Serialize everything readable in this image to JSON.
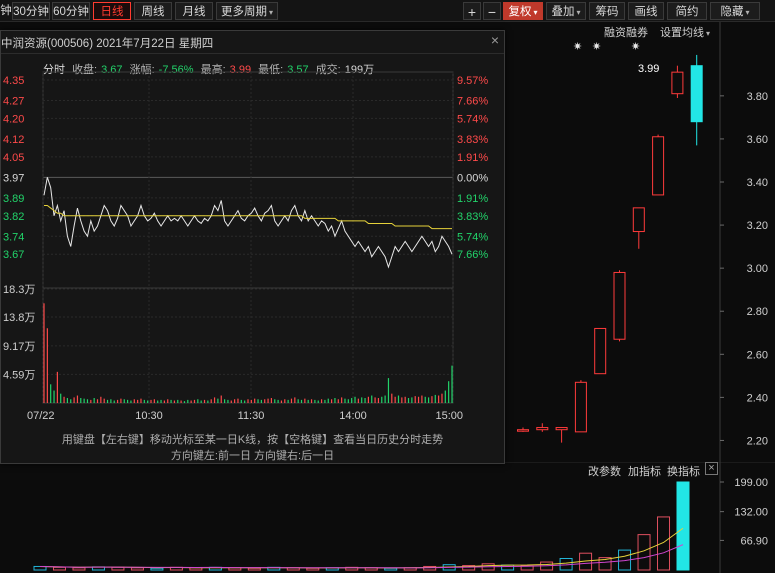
{
  "toolbar": {
    "items": [
      {
        "label": "钟",
        "active": false
      },
      {
        "label": "30分钟",
        "active": false
      },
      {
        "label": "60分钟",
        "active": false
      },
      {
        "label": "日线",
        "active": true
      },
      {
        "label": "周线",
        "active": false
      },
      {
        "label": "月线",
        "active": false
      },
      {
        "label": "更多周期",
        "active": false
      }
    ],
    "right": {
      "plus": "+",
      "minus": "−",
      "fuquan": "复权",
      "diejia": "叠加",
      "chouma": "筹码",
      "huaxian": "画线",
      "jianyue": "简约",
      "yincang": "隐藏"
    },
    "colors": {
      "active": "#ff3b30",
      "fuquan_bg": "#c0392b"
    }
  },
  "main_chart": {
    "top_links": {
      "rongzi": "融资融券",
      "settings": "设置均线"
    },
    "star_glyph": "✷",
    "peak_label": "3.99",
    "price_axis": [
      "3.80",
      "3.60",
      "3.40",
      "3.20",
      "3.00",
      "2.80",
      "2.60",
      "2.40",
      "2.20"
    ]
  },
  "popup": {
    "title": "中润资源(000506) 2021年7月22日 星期四",
    "info": {
      "fenshi": "分时",
      "close_label": "收盘:",
      "close_value": "3.67",
      "change_label": "涨幅:",
      "change_value": "-7.56%",
      "high_label": "最高:",
      "high_value": "3.99",
      "low_label": "最低:",
      "low_value": "3.57",
      "volume_label": "成交:",
      "volume_value": "199万"
    },
    "price_left": [
      "4.35",
      "4.27",
      "4.20",
      "4.12",
      "4.05",
      "3.97",
      "3.89",
      "3.82",
      "3.74",
      "3.67"
    ],
    "pct_right": [
      "9.57%",
      "7.66%",
      "5.74%",
      "3.83%",
      "1.91%",
      "0.00%",
      "1.91%",
      "3.83%",
      "5.74%",
      "7.66%"
    ],
    "vol_axis": [
      "18.3万",
      "13.8万",
      "9.17万",
      "4.59万"
    ],
    "time_axis": [
      "07/22",
      "10:30",
      "11:30",
      "14:00",
      "15:00"
    ],
    "hint1": "用键盘【左右键】移动光标至某一日K线，按【空格键】查看当日历史分时走势",
    "hint2": "方向键左:前一日  方向键右:后一日",
    "close_icon": "×"
  },
  "indicator": {
    "gaicanshu": "改参数",
    "jiazhibiao": "加指标",
    "huanzhibiao": "换指标",
    "close_icon": "×",
    "axis": [
      "199.00",
      "132.00",
      "66.90"
    ]
  },
  "chart_data": {
    "type": "line",
    "title": "中润资源(000506) 2021年7月22日 星期四",
    "prev_close": 3.97,
    "ylim": [
      3.62,
      4.35
    ],
    "x_ticks": [
      "07/22",
      "10:30",
      "11:30",
      "14:00",
      "15:00"
    ],
    "series": [
      {
        "values": [
          3.9,
          3.97,
          3.93,
          3.82,
          3.86,
          3.8,
          3.84,
          3.74,
          3.7,
          3.78,
          3.85,
          3.8,
          3.76,
          3.74,
          3.8,
          3.76,
          3.78,
          3.82,
          3.86,
          3.84,
          3.8,
          3.78,
          3.81,
          3.86,
          3.84,
          3.82,
          3.78,
          3.8,
          3.82,
          3.86,
          3.82,
          3.8,
          3.81,
          3.83,
          3.8,
          3.78,
          3.8,
          3.82,
          3.8,
          3.81,
          3.8,
          3.82,
          3.8,
          3.78,
          3.8,
          3.82,
          3.8,
          3.79,
          3.81,
          3.8,
          3.82,
          3.86,
          3.84,
          3.88,
          3.8,
          3.78,
          3.8,
          3.82,
          3.84,
          3.81,
          3.8,
          3.82,
          3.83,
          3.85,
          3.82,
          3.8,
          3.83,
          3.84,
          3.86,
          3.8,
          3.78,
          3.8,
          3.82,
          3.8,
          3.84,
          3.86,
          3.82,
          3.8,
          3.84,
          3.8,
          3.82,
          3.8,
          3.78,
          3.8,
          3.79,
          3.76,
          3.78,
          3.74,
          3.77,
          3.8,
          3.76,
          3.74,
          3.72,
          3.7,
          3.72,
          3.7,
          3.68,
          3.7,
          3.66,
          3.68,
          3.7,
          3.68,
          3.66,
          3.62,
          3.66,
          3.7,
          3.68,
          3.7,
          3.72,
          3.7,
          3.68,
          3.7,
          3.72,
          3.74,
          3.72,
          3.7,
          3.72,
          3.68,
          3.7,
          3.74,
          3.72,
          3.7,
          3.67
        ]
      },
      {
        "values": [
          3.86,
          3.86,
          3.85,
          3.84,
          3.83,
          3.83,
          3.82,
          3.82,
          3.82,
          3.82,
          3.82,
          3.82,
          3.82,
          3.82,
          3.82,
          3.82,
          3.82,
          3.82,
          3.82,
          3.82,
          3.82,
          3.82,
          3.82,
          3.82,
          3.82,
          3.82,
          3.82,
          3.82,
          3.82,
          3.82,
          3.82,
          3.82,
          3.82,
          3.82,
          3.82,
          3.82,
          3.82,
          3.82,
          3.82,
          3.82,
          3.82,
          3.82,
          3.82,
          3.82,
          3.82,
          3.82,
          3.82,
          3.82,
          3.82,
          3.82,
          3.82,
          3.82,
          3.82,
          3.82,
          3.82,
          3.82,
          3.82,
          3.82,
          3.82,
          3.82,
          3.82,
          3.82,
          3.82,
          3.82,
          3.82,
          3.82,
          3.82,
          3.82,
          3.82,
          3.82,
          3.82,
          3.82,
          3.82,
          3.82,
          3.82,
          3.82,
          3.82,
          3.82,
          3.81,
          3.81,
          3.81,
          3.81,
          3.81,
          3.81,
          3.81,
          3.81,
          3.81,
          3.81,
          3.8,
          3.8,
          3.8,
          3.8,
          3.8,
          3.8,
          3.8,
          3.8,
          3.8,
          3.79,
          3.79,
          3.79,
          3.79,
          3.79,
          3.79,
          3.79,
          3.79,
          3.78,
          3.78,
          3.78,
          3.78,
          3.78,
          3.78,
          3.78,
          3.78,
          3.78,
          3.78,
          3.78,
          3.77,
          3.77,
          3.77,
          3.77,
          3.77,
          3.77,
          3.77
        ]
      }
    ],
    "volume_ylim": [
      0,
      183000
    ],
    "volume": [
      160000,
      120000,
      30000,
      20000,
      50000,
      15000,
      10000,
      8000,
      6000,
      9000,
      12000,
      8000,
      7000,
      6000,
      5000,
      8000,
      6000,
      10000,
      7000,
      5000,
      6000,
      4000,
      5000,
      7000,
      6000,
      5000,
      4000,
      6000,
      5000,
      7000,
      5000,
      4000,
      5000,
      6000,
      4000,
      5000,
      4000,
      6000,
      5000,
      4000,
      5000,
      4000,
      3000,
      5000,
      4000,
      5000,
      6000,
      4000,
      5000,
      4000,
      6000,
      9000,
      7000,
      12000,
      6000,
      5000,
      4000,
      6000,
      7000,
      5000,
      4000,
      6000,
      5000,
      7000,
      6000,
      5000,
      6000,
      7000,
      8000,
      6000,
      5000,
      4000,
      6000,
      5000,
      7000,
      9000,
      6000,
      5000,
      7000,
      5000,
      6000,
      5000,
      4000,
      6000,
      5000,
      7000,
      6000,
      8000,
      6000,
      9000,
      7000,
      6000,
      8000,
      10000,
      7000,
      9000,
      8000,
      10000,
      12000,
      9000,
      8000,
      10000,
      12000,
      40000,
      15000,
      10000,
      12000,
      9000,
      10000,
      8000,
      9000,
      11000,
      10000,
      12000,
      10000,
      9000,
      11000,
      13000,
      12000,
      15000,
      20000,
      35000,
      60000
    ],
    "daily_ylim": [
      2.1,
      4.05
    ],
    "daily_candles": [
      {
        "o": 2.25,
        "h": 2.26,
        "l": 2.24,
        "c": 2.25
      },
      {
        "o": 2.25,
        "h": 2.28,
        "l": 2.24,
        "c": 2.26
      },
      {
        "o": 2.25,
        "h": 2.26,
        "l": 2.19,
        "c": 2.26
      },
      {
        "o": 2.24,
        "h": 2.48,
        "l": 2.24,
        "c": 2.47
      },
      {
        "o": 2.51,
        "h": 2.71,
        "l": 2.51,
        "c": 2.72
      },
      {
        "o": 2.67,
        "h": 2.99,
        "l": 2.66,
        "c": 2.98
      },
      {
        "o": 3.17,
        "h": 3.28,
        "l": 3.09,
        "c": 3.28
      },
      {
        "o": 3.34,
        "h": 3.62,
        "l": 3.34,
        "c": 3.61
      },
      {
        "o": 3.81,
        "h": 3.94,
        "l": 3.79,
        "c": 3.91
      },
      {
        "o": 3.94,
        "h": 3.99,
        "l": 3.57,
        "c": 3.68
      }
    ],
    "indicator_ylim": [
      0,
      199
    ],
    "indicator_bars": [
      8,
      6,
      5,
      7,
      6,
      5,
      4,
      6,
      5,
      6,
      5,
      4,
      6,
      5,
      4,
      5,
      6,
      5,
      4,
      5,
      8,
      12,
      10,
      14,
      11,
      9,
      18,
      26,
      38,
      28,
      45,
      80,
      120,
      199
    ]
  }
}
